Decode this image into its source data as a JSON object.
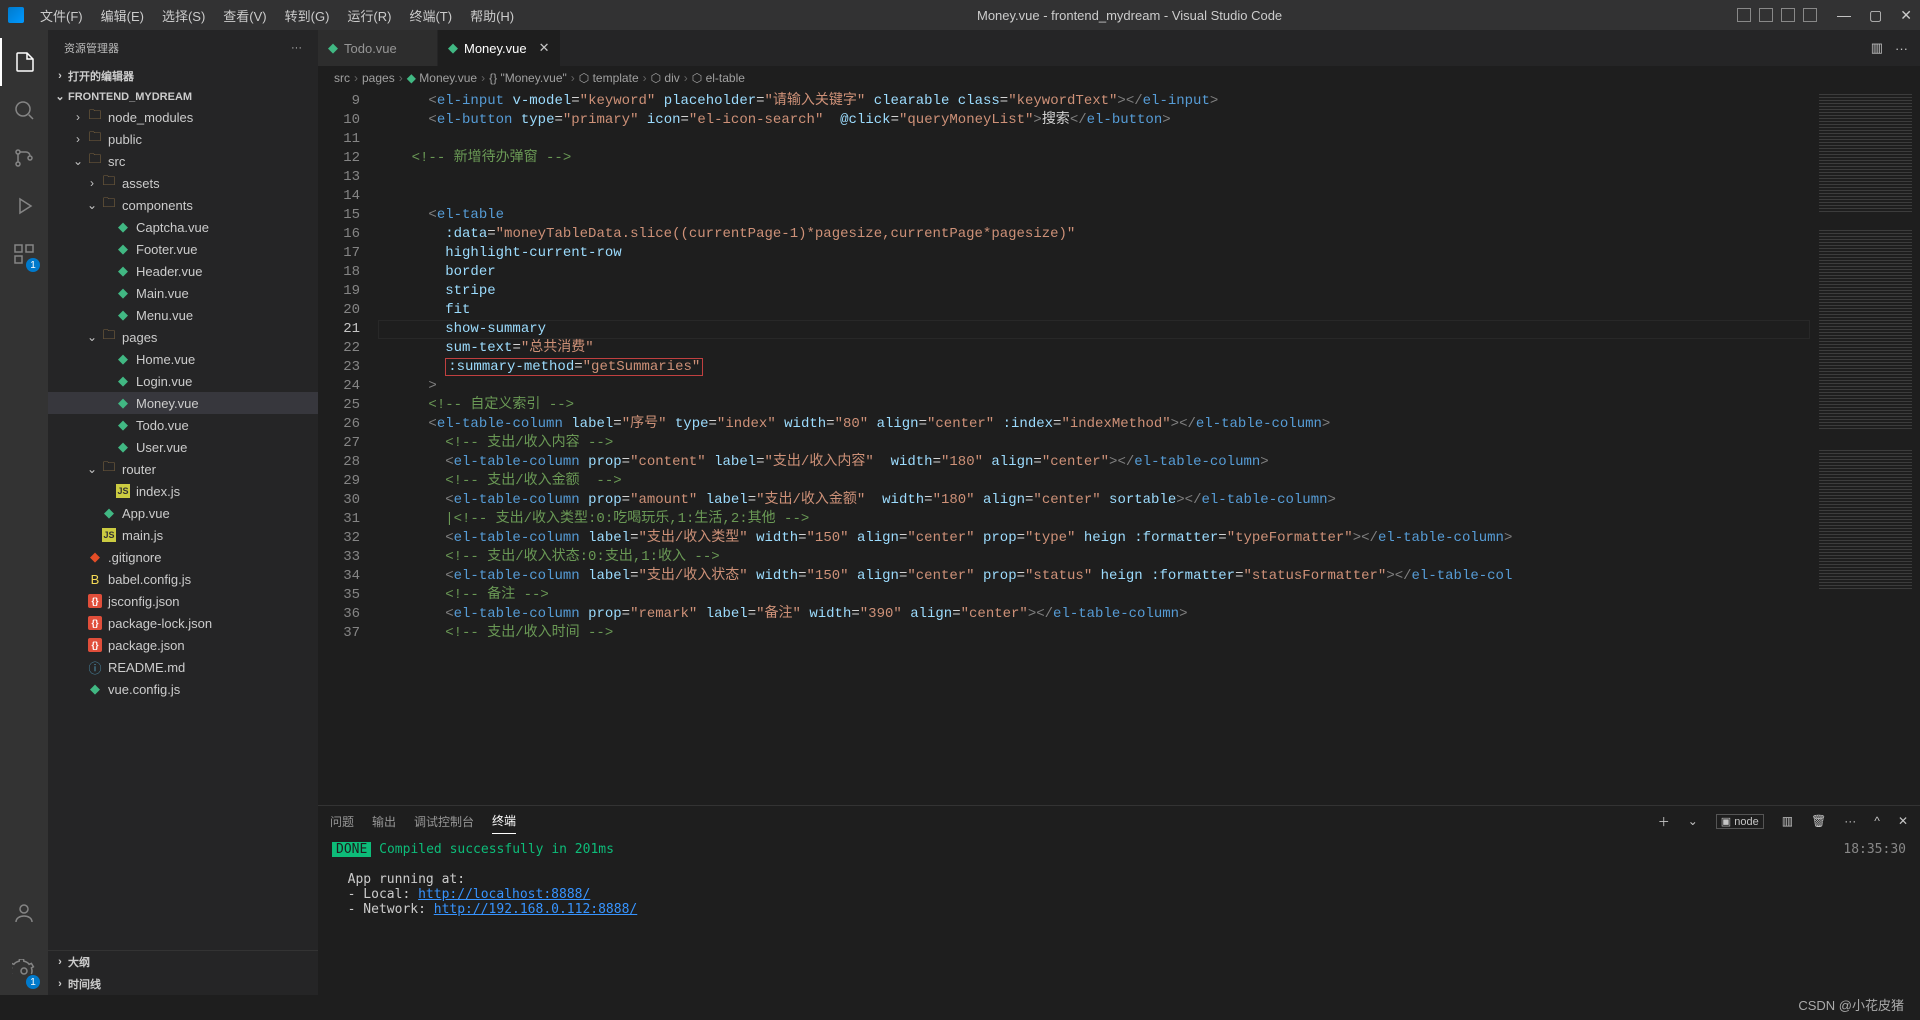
{
  "title": "Money.vue - frontend_mydream - Visual Studio Code",
  "menu": [
    "文件(F)",
    "编辑(E)",
    "选择(S)",
    "查看(V)",
    "转到(G)",
    "运行(R)",
    "终端(T)",
    "帮助(H)"
  ],
  "sidebar": {
    "header": "资源管理器",
    "more": "···",
    "openEditors": "打开的编辑器",
    "project": "FRONTEND_MYDREAM",
    "tree": [
      {
        "depth": 1,
        "chev": ">",
        "icon": "folder-mod",
        "label": "node_modules"
      },
      {
        "depth": 1,
        "chev": ">",
        "icon": "folder",
        "label": "public"
      },
      {
        "depth": 1,
        "chev": "v",
        "icon": "folder",
        "label": "src"
      },
      {
        "depth": 2,
        "chev": ">",
        "icon": "folder",
        "label": "assets"
      },
      {
        "depth": 2,
        "chev": "v",
        "icon": "folder",
        "label": "components"
      },
      {
        "depth": 3,
        "chev": "",
        "icon": "vue",
        "label": "Captcha.vue"
      },
      {
        "depth": 3,
        "chev": "",
        "icon": "vue",
        "label": "Footer.vue"
      },
      {
        "depth": 3,
        "chev": "",
        "icon": "vue",
        "label": "Header.vue"
      },
      {
        "depth": 3,
        "chev": "",
        "icon": "vue",
        "label": "Main.vue"
      },
      {
        "depth": 3,
        "chev": "",
        "icon": "vue",
        "label": "Menu.vue"
      },
      {
        "depth": 2,
        "chev": "v",
        "icon": "folder",
        "label": "pages"
      },
      {
        "depth": 3,
        "chev": "",
        "icon": "vue",
        "label": "Home.vue"
      },
      {
        "depth": 3,
        "chev": "",
        "icon": "vue",
        "label": "Login.vue"
      },
      {
        "depth": 3,
        "chev": "",
        "icon": "vue",
        "label": "Money.vue",
        "selected": true
      },
      {
        "depth": 3,
        "chev": "",
        "icon": "vue",
        "label": "Todo.vue"
      },
      {
        "depth": 3,
        "chev": "",
        "icon": "vue",
        "label": "User.vue"
      },
      {
        "depth": 2,
        "chev": "v",
        "icon": "folder",
        "label": "router"
      },
      {
        "depth": 3,
        "chev": "",
        "icon": "js",
        "label": "index.js"
      },
      {
        "depth": 2,
        "chev": "",
        "icon": "vue",
        "label": "App.vue"
      },
      {
        "depth": 2,
        "chev": "",
        "icon": "js",
        "label": "main.js"
      },
      {
        "depth": 1,
        "chev": "",
        "icon": "git",
        "label": ".gitignore"
      },
      {
        "depth": 1,
        "chev": "",
        "icon": "babel",
        "label": "babel.config.js"
      },
      {
        "depth": 1,
        "chev": "",
        "icon": "json",
        "label": "jsconfig.json"
      },
      {
        "depth": 1,
        "chev": "",
        "icon": "json",
        "label": "package-lock.json"
      },
      {
        "depth": 1,
        "chev": "",
        "icon": "json",
        "label": "package.json"
      },
      {
        "depth": 1,
        "chev": "",
        "icon": "md",
        "label": "README.md"
      },
      {
        "depth": 1,
        "chev": "",
        "icon": "vue",
        "label": "vue.config.js"
      }
    ],
    "outline": "大纲",
    "timeline": "时间线"
  },
  "tabs": [
    {
      "label": "Todo.vue",
      "active": false
    },
    {
      "label": "Money.vue",
      "active": true
    }
  ],
  "breadcrumb": [
    "src",
    "pages",
    "Money.vue",
    "\"Money.vue\"",
    "template",
    "div",
    "el-table"
  ],
  "code": {
    "startLine": 9,
    "activeLine": 21,
    "lines": [
      {
        "n": 9,
        "html": "      <span class='tk-punc'>&lt;</span><span class='tk-tag'>el-input</span> <span class='tk-attr'>v-model</span>=<span class='tk-str'>\"keyword\"</span> <span class='tk-attr'>placeholder</span>=<span class='tk-str'>\"请输入关键字\"</span> <span class='tk-attr'>clearable</span> <span class='tk-attr'>class</span>=<span class='tk-str'>\"keywordText\"</span><span class='tk-punc'>&gt;&lt;/</span><span class='tk-tag'>el-input</span><span class='tk-punc'>&gt;</span>"
      },
      {
        "n": 10,
        "html": "      <span class='tk-punc'>&lt;</span><span class='tk-tag'>el-button</span> <span class='tk-attr'>type</span>=<span class='tk-str'>\"primary\"</span> <span class='tk-attr'>icon</span>=<span class='tk-str'>\"el-icon-search\"</span>  <span class='tk-attr'>@click</span>=<span class='tk-str'>\"queryMoneyList\"</span><span class='tk-punc'>&gt;</span><span class='tk-text'>搜索</span><span class='tk-punc'>&lt;/</span><span class='tk-tag'>el-button</span><span class='tk-punc'>&gt;</span>"
      },
      {
        "n": 11,
        "html": ""
      },
      {
        "n": 12,
        "html": "    <span class='tk-comment'>&lt;!-- 新增待办弹窗 --&gt;</span>"
      },
      {
        "n": 13,
        "html": ""
      },
      {
        "n": 14,
        "html": ""
      },
      {
        "n": 15,
        "html": "      <span class='tk-punc'>&lt;</span><span class='tk-tag'>el-table</span>"
      },
      {
        "n": 16,
        "html": "        <span class='tk-attr'>:data</span>=<span class='tk-str'>\"moneyTableData.slice((currentPage-1)*pagesize,currentPage*pagesize)\"</span>"
      },
      {
        "n": 17,
        "html": "        <span class='tk-attr'>highlight-current-row</span>"
      },
      {
        "n": 18,
        "html": "        <span class='tk-attr'>border</span>"
      },
      {
        "n": 19,
        "html": "        <span class='tk-attr'>stripe</span>"
      },
      {
        "n": 20,
        "html": "        <span class='tk-attr'>fit</span>"
      },
      {
        "n": 21,
        "html": "        <span class='tk-attr'>show-summary</span>"
      },
      {
        "n": 22,
        "html": "        <span class='tk-attr'>sum-text</span>=<span class='tk-str'>\"总共消费\"</span>"
      },
      {
        "n": 23,
        "html": "        <span class='redbox'><span class='tk-attr'>:summary-method</span>=<span class='tk-str'>\"getSummaries\"</span></span>"
      },
      {
        "n": 24,
        "html": "      <span class='tk-punc'>&gt;</span>"
      },
      {
        "n": 25,
        "html": "      <span class='tk-comment'>&lt;!-- 自定义索引 --&gt;</span>"
      },
      {
        "n": 26,
        "html": "      <span class='tk-punc'>&lt;</span><span class='tk-tag'>el-table-column</span> <span class='tk-attr'>label</span>=<span class='tk-str'>\"序号\"</span> <span class='tk-attr'>type</span>=<span class='tk-str'>\"index\"</span> <span class='tk-attr'>width</span>=<span class='tk-str'>\"80\"</span> <span class='tk-attr'>align</span>=<span class='tk-str'>\"center\"</span> <span class='tk-attr'>:index</span>=<span class='tk-str'>\"indexMethod\"</span><span class='tk-punc'>&gt;&lt;/</span><span class='tk-tag'>el-table-column</span><span class='tk-punc'>&gt;</span>"
      },
      {
        "n": 27,
        "html": "        <span class='tk-comment'>&lt;!-- 支出/收入内容 --&gt;</span>"
      },
      {
        "n": 28,
        "html": "        <span class='tk-punc'>&lt;</span><span class='tk-tag'>el-table-column</span> <span class='tk-attr'>prop</span>=<span class='tk-str'>\"content\"</span> <span class='tk-attr'>label</span>=<span class='tk-str'>\"支出/收入内容\"</span>  <span class='tk-attr'>width</span>=<span class='tk-str'>\"180\"</span> <span class='tk-attr'>align</span>=<span class='tk-str'>\"center\"</span><span class='tk-punc'>&gt;&lt;/</span><span class='tk-tag'>el-table-column</span><span class='tk-punc'>&gt;</span>"
      },
      {
        "n": 29,
        "html": "        <span class='tk-comment'>&lt;!-- 支出/收入金额  --&gt;</span>"
      },
      {
        "n": 30,
        "html": "        <span class='tk-punc'>&lt;</span><span class='tk-tag'>el-table-column</span> <span class='tk-attr'>prop</span>=<span class='tk-str'>\"amount\"</span> <span class='tk-attr'>label</span>=<span class='tk-str'>\"支出/收入金额\"</span>  <span class='tk-attr'>width</span>=<span class='tk-str'>\"180\"</span> <span class='tk-attr'>align</span>=<span class='tk-str'>\"center\"</span> <span class='tk-attr'>sortable</span><span class='tk-punc'>&gt;&lt;/</span><span class='tk-tag'>el-table-column</span><span class='tk-punc'>&gt;</span>"
      },
      {
        "n": 31,
        "html": "        <span class='tk-comment'>|&lt;!-- 支出/收入类型:0:吃喝玩乐,1:生活,2:其他 --&gt;</span>"
      },
      {
        "n": 32,
        "html": "        <span class='tk-punc'>&lt;</span><span class='tk-tag'>el-table-column</span> <span class='tk-attr'>label</span>=<span class='tk-str'>\"支出/收入类型\"</span> <span class='tk-attr'>width</span>=<span class='tk-str'>\"150\"</span> <span class='tk-attr'>align</span>=<span class='tk-str'>\"center\"</span> <span class='tk-attr'>prop</span>=<span class='tk-str'>\"type\"</span> <span class='tk-attr'>heign</span> <span class='tk-attr'>:formatter</span>=<span class='tk-str'>\"typeFormatter\"</span><span class='tk-punc'>&gt;&lt;/</span><span class='tk-tag'>el-table-column</span><span class='tk-punc'>&gt;</span>"
      },
      {
        "n": 33,
        "html": "        <span class='tk-comment'>&lt;!-- 支出/收入状态:0:支出,1:收入 --&gt;</span>"
      },
      {
        "n": 34,
        "html": "        <span class='tk-punc'>&lt;</span><span class='tk-tag'>el-table-column</span> <span class='tk-attr'>label</span>=<span class='tk-str'>\"支出/收入状态\"</span> <span class='tk-attr'>width</span>=<span class='tk-str'>\"150\"</span> <span class='tk-attr'>align</span>=<span class='tk-str'>\"center\"</span> <span class='tk-attr'>prop</span>=<span class='tk-str'>\"status\"</span> <span class='tk-attr'>heign</span> <span class='tk-attr'>:formatter</span>=<span class='tk-str'>\"statusFormatter\"</span><span class='tk-punc'>&gt;&lt;/</span><span class='tk-tag'>el-table-col</span>"
      },
      {
        "n": 35,
        "html": "        <span class='tk-comment'>&lt;!-- 备注 --&gt;</span>"
      },
      {
        "n": 36,
        "html": "        <span class='tk-punc'>&lt;</span><span class='tk-tag'>el-table-column</span> <span class='tk-attr'>prop</span>=<span class='tk-str'>\"remark\"</span> <span class='tk-attr'>label</span>=<span class='tk-str'>\"备注\"</span> <span class='tk-attr'>width</span>=<span class='tk-str'>\"390\"</span> <span class='tk-attr'>align</span>=<span class='tk-str'>\"center\"</span><span class='tk-punc'>&gt;&lt;/</span><span class='tk-tag'>el-table-column</span><span class='tk-punc'>&gt;</span>"
      },
      {
        "n": 37,
        "html": "        <span class='tk-comment'>&lt;!-- 支出/收入时间 --&gt;</span>"
      }
    ]
  },
  "panel": {
    "tabs": [
      "问题",
      "输出",
      "调试控制台",
      "终端"
    ],
    "activeTab": 3,
    "termIcon": "node",
    "time": "18:35:30",
    "done": "DONE",
    "compiled": "Compiled successfully in 201ms",
    "running": "App running at:",
    "local_lbl": "- Local:   ",
    "local_url": "http://localhost:8888/",
    "net_lbl": "- Network: ",
    "net_url": "http://192.168.0.112:8888/"
  },
  "watermark": "CSDN @小花皮猪"
}
